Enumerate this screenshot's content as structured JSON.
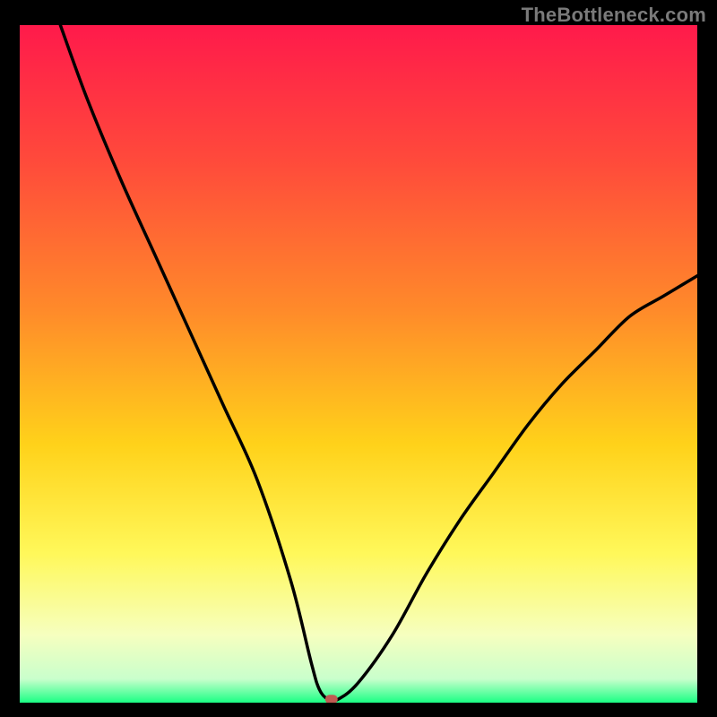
{
  "watermark": "TheBottleneck.com",
  "chart_data": {
    "type": "line",
    "title": "",
    "xlabel": "",
    "ylabel": "",
    "xlim": [
      0,
      100
    ],
    "ylim": [
      0,
      100
    ],
    "grid": false,
    "series": [
      {
        "name": "bottleneck-curve",
        "color": "#000000",
        "x": [
          6,
          10,
          15,
          20,
          25,
          30,
          35,
          40,
          43,
          44.2,
          45.5,
          47,
          50,
          55,
          60,
          65,
          70,
          75,
          80,
          85,
          90,
          95,
          100
        ],
        "y": [
          100,
          89,
          77,
          66,
          55,
          44,
          33,
          18,
          6,
          2,
          0.5,
          0.5,
          3,
          10,
          19,
          27,
          34,
          41,
          47,
          52,
          57,
          60,
          63
        ]
      }
    ],
    "marker": {
      "name": "optimal-point",
      "x": 46,
      "y": 0.5,
      "color": "#c05a52"
    },
    "gradient_stops": [
      {
        "offset": 0.0,
        "color": "#ff1a4b"
      },
      {
        "offset": 0.2,
        "color": "#ff4a3b"
      },
      {
        "offset": 0.42,
        "color": "#ff8a2a"
      },
      {
        "offset": 0.62,
        "color": "#ffd21a"
      },
      {
        "offset": 0.78,
        "color": "#fff85a"
      },
      {
        "offset": 0.9,
        "color": "#f6ffbf"
      },
      {
        "offset": 0.965,
        "color": "#c9ffcc"
      },
      {
        "offset": 1.0,
        "color": "#1aff84"
      }
    ]
  }
}
